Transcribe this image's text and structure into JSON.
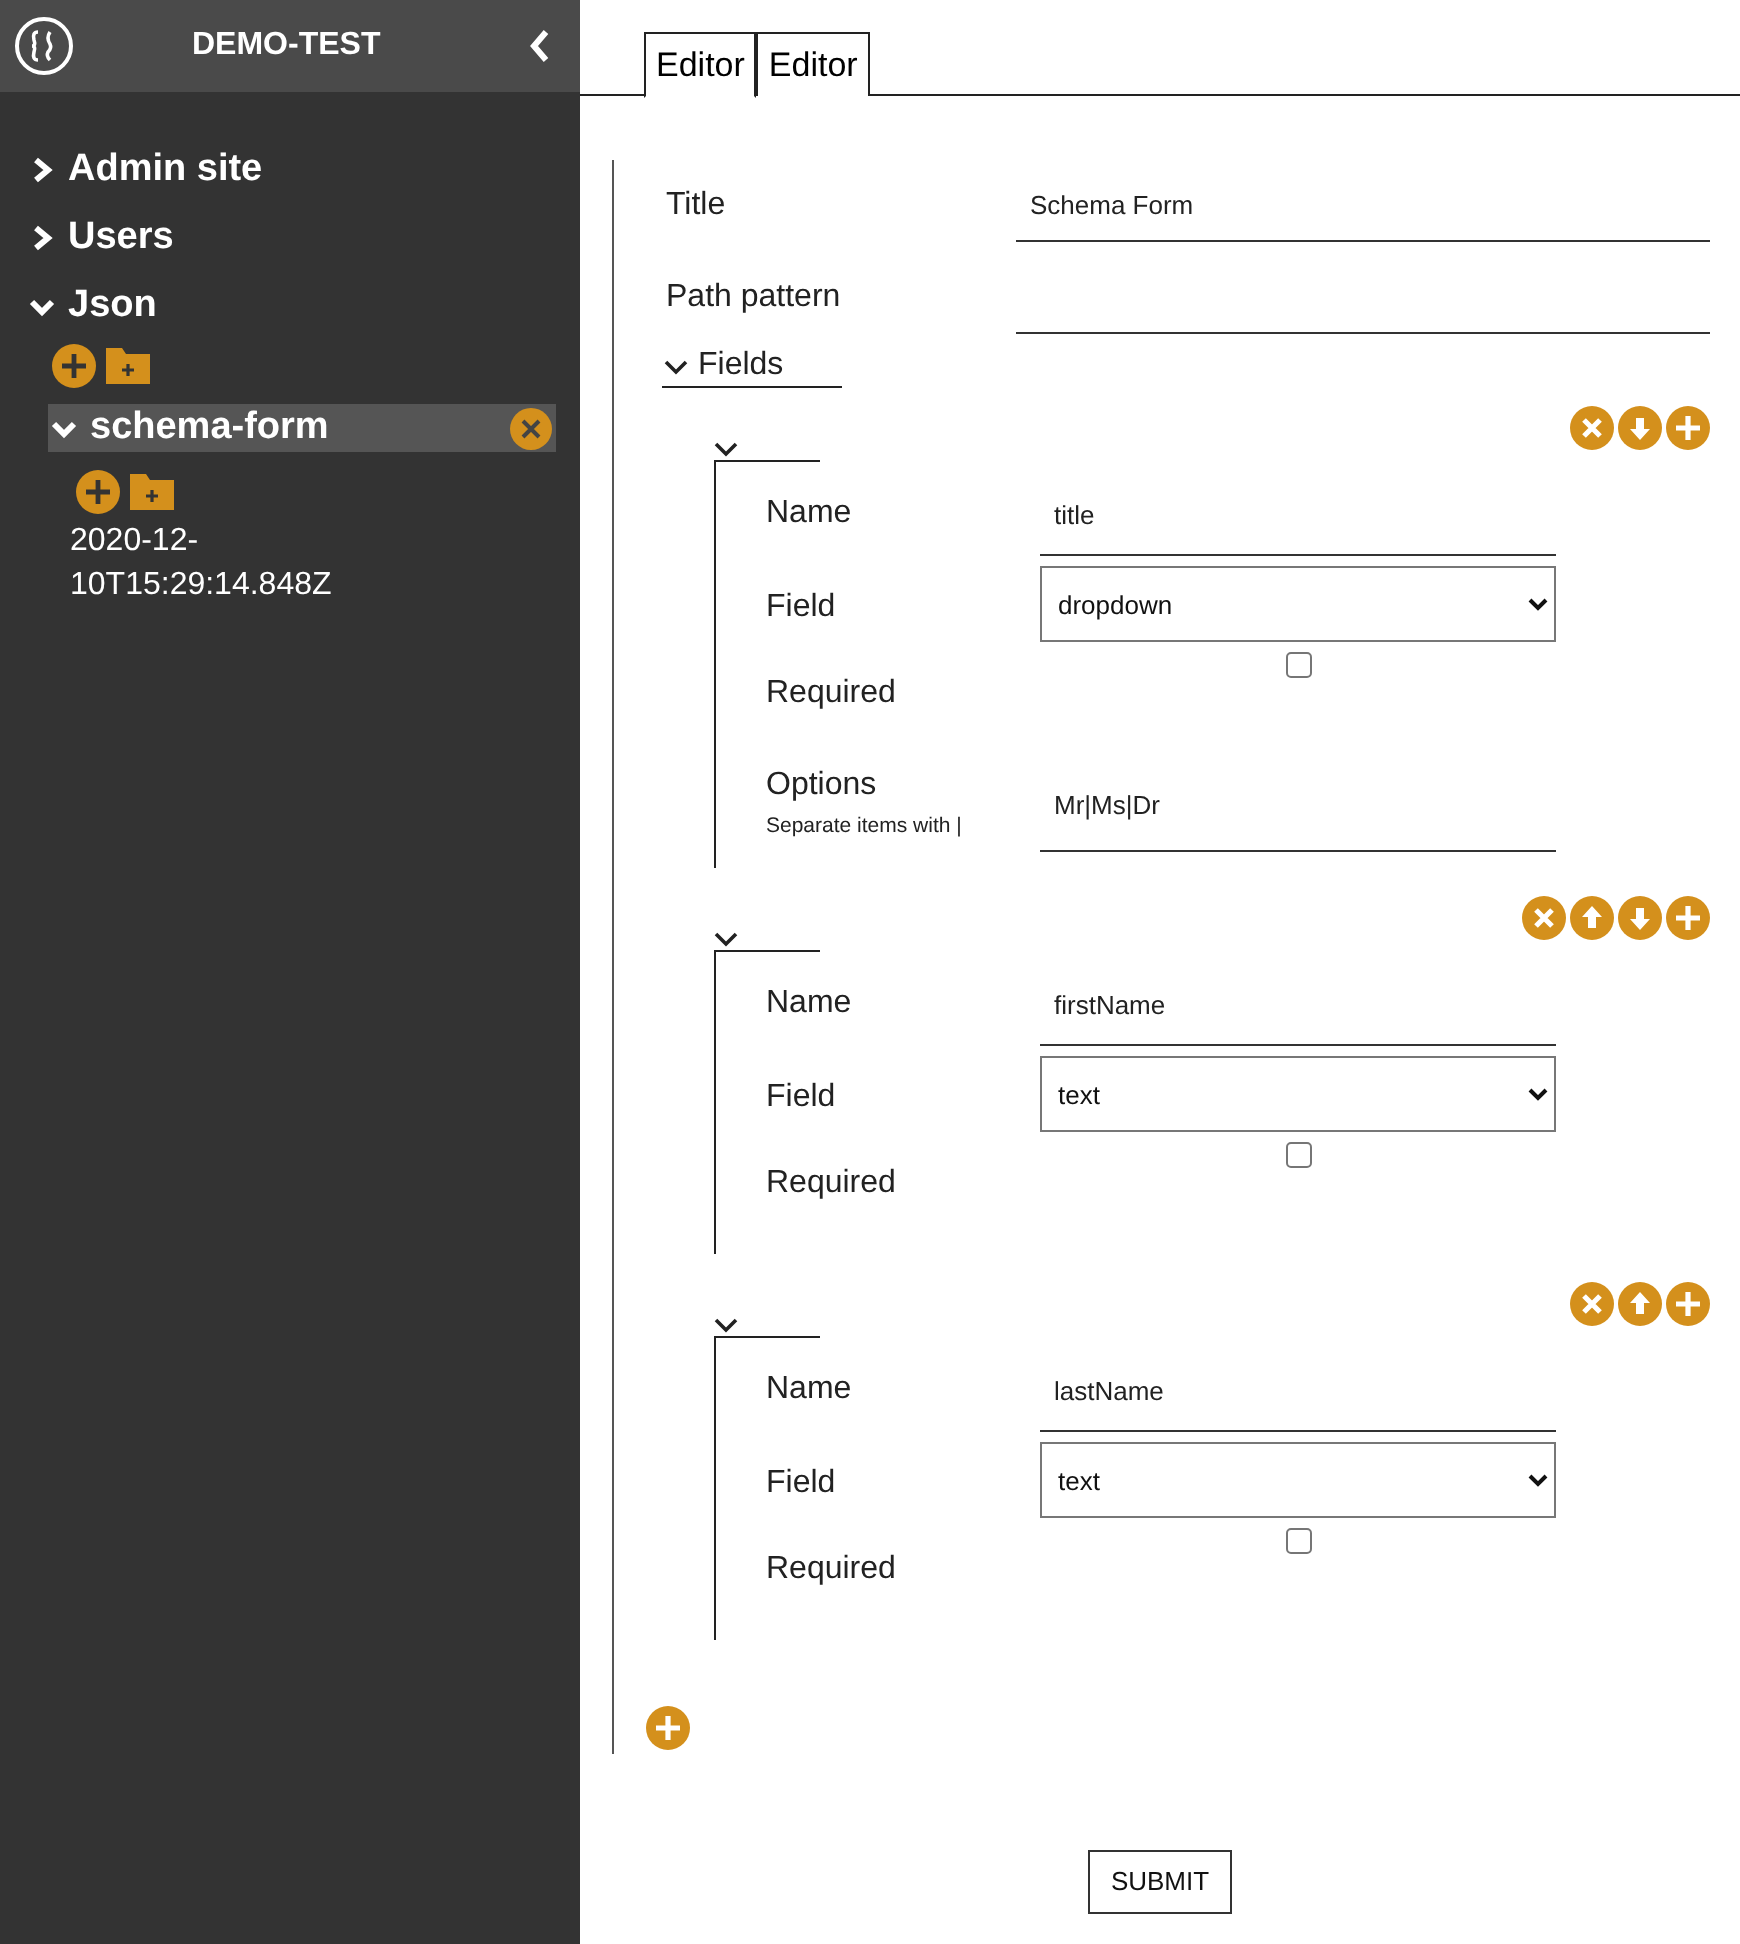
{
  "sidebar": {
    "title": "DEMO-TEST",
    "nav": [
      {
        "label": "Admin site",
        "expanded": false
      },
      {
        "label": "Users",
        "expanded": false
      },
      {
        "label": "Json",
        "expanded": true,
        "children": [
          {
            "label": "schema-form",
            "expanded": true,
            "selected": true,
            "children": [
              {
                "label": "2020-12-10T15:29:14.848Z"
              }
            ]
          }
        ]
      }
    ]
  },
  "tabs": [
    {
      "label": "Editor",
      "selected": true
    },
    {
      "label": "Editor",
      "selected": false
    }
  ],
  "form": {
    "rows": [
      {
        "label": "Title",
        "value": "Schema Form"
      },
      {
        "label": "Path pattern"
      }
    ],
    "fields": {
      "label": "Fields",
      "expanded": true,
      "items": [
        {
          "expanded": true,
          "actions": [
            {
              "kind": "remove"
            },
            {
              "kind": "down"
            },
            {
              "kind": "add"
            }
          ],
          "rows": [
            {
              "kind": "text",
              "label": "Name",
              "value": "title"
            },
            {
              "kind": "select",
              "label": "Field",
              "value": "dropdown"
            },
            {
              "kind": "checkbox",
              "label": "Required",
              "checked": false
            },
            {
              "kind": "text",
              "label": "Options",
              "hint": "Separate items with |",
              "value": "Mr|Ms|Dr"
            }
          ]
        },
        {
          "expanded": true,
          "actions": [
            {
              "kind": "remove"
            },
            {
              "kind": "up"
            },
            {
              "kind": "down"
            },
            {
              "kind": "add"
            }
          ],
          "rows": [
            {
              "kind": "text",
              "label": "Name",
              "value": "firstName"
            },
            {
              "kind": "select",
              "label": "Field",
              "value": "text"
            },
            {
              "kind": "checkbox",
              "label": "Required",
              "checked": false
            }
          ]
        },
        {
          "expanded": true,
          "actions": [
            {
              "kind": "remove"
            },
            {
              "kind": "up"
            },
            {
              "kind": "add"
            }
          ],
          "rows": [
            {
              "kind": "text",
              "label": "Name",
              "value": "lastName"
            },
            {
              "kind": "select",
              "label": "Field",
              "value": "text"
            },
            {
              "kind": "checkbox",
              "label": "Required",
              "checked": false
            }
          ]
        }
      ]
    }
  },
  "submit": "SUBMIT"
}
